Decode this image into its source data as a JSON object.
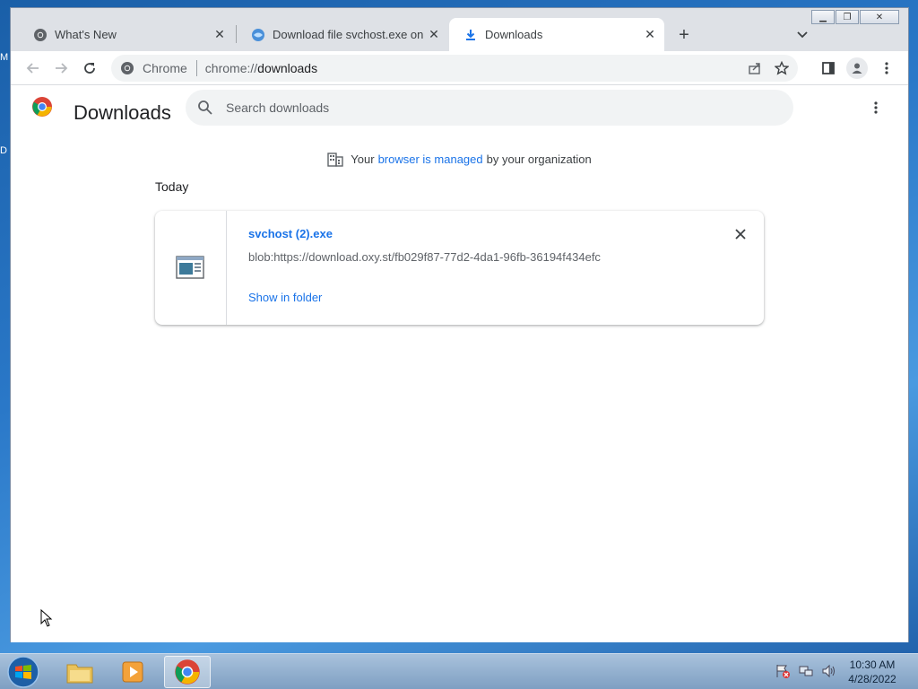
{
  "desktop": {
    "edge_label_1": "M",
    "edge_label_2": "D"
  },
  "tabs": [
    {
      "title": "What's New",
      "icon": "chrome-icon"
    },
    {
      "title": "Download file svchost.exe on Oxy",
      "icon": "oxy-globe-icon"
    },
    {
      "title": "Downloads",
      "icon": "download-icon",
      "active": true
    }
  ],
  "toolbar": {
    "site_chip": "Chrome",
    "url_scheme": "chrome://",
    "url_path": "downloads"
  },
  "page": {
    "title": "Downloads",
    "search_placeholder": "Search downloads",
    "managed_prefix": "Your",
    "managed_link": "browser is managed",
    "managed_suffix": "by your organization",
    "day_label": "Today"
  },
  "download": {
    "filename": "svchost (2).exe",
    "url": "blob:https://download.oxy.st/fb029f87-77d2-4da1-96fb-36194f434efc",
    "show_in_folder": "Show in folder"
  },
  "taskbar": {
    "time": "10:30 AM",
    "date": "4/28/2022"
  },
  "colors": {
    "link": "#1a73e8",
    "tabstrip": "#dee1e6",
    "omnibox": "#f1f3f4"
  }
}
